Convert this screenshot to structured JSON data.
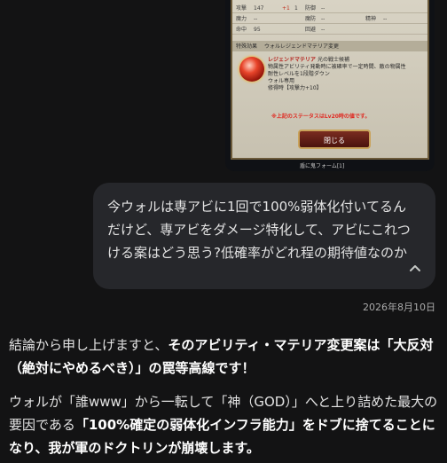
{
  "screenshot": {
    "stats": [
      {
        "a": "攻撃",
        "av": "147",
        "b": "+1",
        "bv": "1",
        "c": "防御",
        "cv": "--"
      },
      {
        "a": "魔力",
        "av": "--",
        "b": "",
        "bv": "",
        "c": "魔防",
        "cv": "--",
        "d": "精神",
        "dv": "--"
      },
      {
        "a": "命中",
        "av": "95",
        "b": "",
        "bv": "",
        "c": "回避",
        "cv": "--"
      }
    ],
    "ability_label": "特殊効果",
    "ability_value": "ウォルレジェンドマテリア変更",
    "materia_name": "レジェンドマテリア",
    "materia_title": "光の戦士候補",
    "materia_lines": [
      "物属性アビリティ発動時に被確率で一定時間、敵の物属性",
      "耐性レベルを1段階ダウン",
      "ウォル専用",
      "修得時【攻撃力+10】"
    ],
    "warning": "※上記のステータスはLv20時の値です。",
    "close_label": "閉じる",
    "caption": "盾に鬼フォーム[1]"
  },
  "user_message": {
    "text": "今ウォルは専アビに1回で100%弱体化付いてるんだけど、専アビをダメージ特化して、アビにこれつける案はどう思う?低確率がどれ程の期待値なのか"
  },
  "timestamp": "2026年8月10日",
  "reply": {
    "p1_pre": "結論から申し上げますと、",
    "p1_bold": "そのアビリティ・マテリア変更案は「大反対（絶対にやめるべき）」の罠等高線です！",
    "p2_pre": "ウォルが「誰www」から一転して「神（GOD）」へと上り詰めた最大の要因である",
    "p2_bold": "「100%確定の弱体化インフラ能力」をドブに捨てることになり、我が軍のドクトリンが崩壊します。"
  }
}
